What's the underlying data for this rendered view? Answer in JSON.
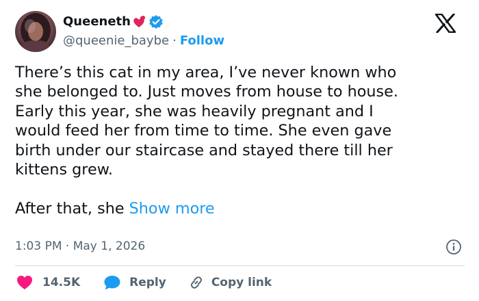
{
  "author": {
    "display_name": "Queeneth",
    "name_emoji": "heart-on-fire-emoji",
    "verified": true,
    "handle": "@queenie_baybe",
    "separator": "·",
    "follow_label": "Follow"
  },
  "tweet": {
    "lines": [
      "There’s this cat in my area, I’ve never known who",
      "she belonged to. Just moves from house to house.",
      "Early this year, she was heavily pregnant and I",
      "would feed her from time to time. She even gave",
      "birth under our staircase and stayed there till her",
      "kittens grew."
    ],
    "last_line_prefix": "After that, she ",
    "show_more_label": "Show more"
  },
  "meta": {
    "timestamp": "1:03 PM · May 1, 2026"
  },
  "actions": {
    "like_count": "14.5K",
    "reply_label": "Reply",
    "copy_link_label": "Copy link"
  },
  "colors": {
    "text": "#0f1419",
    "secondary": "#536471",
    "link": "#1d9bf0",
    "like": "#f91880",
    "divider": "#cfd9de"
  },
  "icons": [
    "x-logo-icon",
    "verified-badge-icon",
    "info-icon",
    "heart-icon",
    "reply-bubble-icon",
    "link-icon"
  ]
}
